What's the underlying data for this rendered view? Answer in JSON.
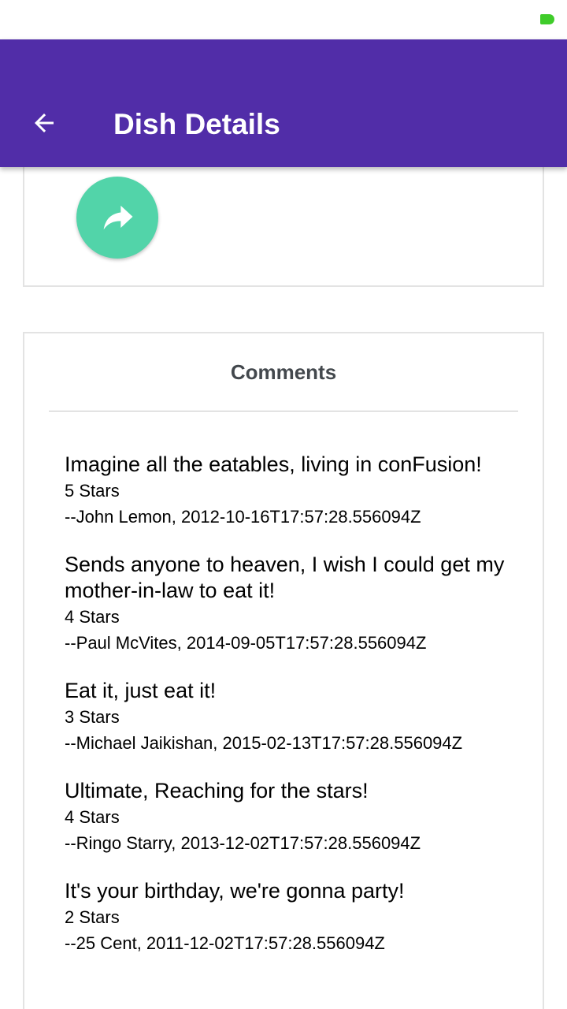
{
  "app_bar": {
    "title": "Dish Details"
  },
  "colors": {
    "primary": "#512da8",
    "accent": "#52d4a9",
    "battery": "#3fcc2a"
  },
  "icons": {
    "back": "arrow-left-icon",
    "share": "share-icon",
    "battery": "battery-icon"
  },
  "comments_section": {
    "title": "Comments",
    "items": [
      {
        "text": "Imagine all the eatables, living in conFusion!",
        "rating": "5 Stars",
        "author": "--John Lemon, 2012-10-16T17:57:28.556094Z"
      },
      {
        "text": "Sends anyone to heaven, I wish I could get my mother-in-law to eat it!",
        "rating": "4 Stars",
        "author": "--Paul McVites, 2014-09-05T17:57:28.556094Z"
      },
      {
        "text": "Eat it, just eat it!",
        "rating": "3 Stars",
        "author": "--Michael Jaikishan, 2015-02-13T17:57:28.556094Z"
      },
      {
        "text": "Ultimate, Reaching for the stars!",
        "rating": "4 Stars",
        "author": "--Ringo Starry, 2013-12-02T17:57:28.556094Z"
      },
      {
        "text": "It's your birthday, we're gonna party!",
        "rating": "2 Stars",
        "author": "--25 Cent, 2011-12-02T17:57:28.556094Z"
      }
    ]
  }
}
